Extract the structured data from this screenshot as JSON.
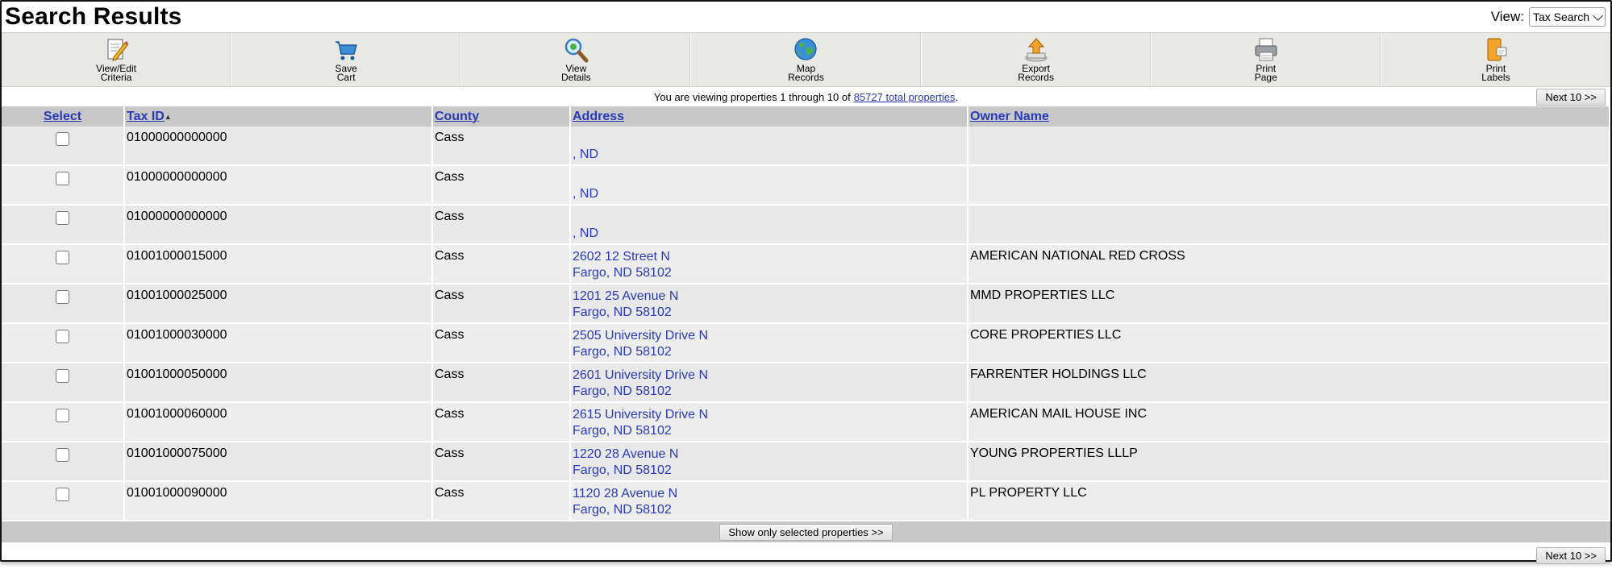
{
  "header": {
    "title": "Search Results",
    "view_label": "View:",
    "view_selected": "Tax Search"
  },
  "toolbar": [
    {
      "name": "view-edit-criteria",
      "icon": "edit-document-icon",
      "line1": "View/Edit",
      "line2": "Criteria"
    },
    {
      "name": "save-cart",
      "icon": "shopping-cart-icon",
      "line1": "Save",
      "line2": "Cart"
    },
    {
      "name": "view-details",
      "icon": "magnifier-icon",
      "line1": "View",
      "line2": "Details"
    },
    {
      "name": "map-records",
      "icon": "globe-icon",
      "line1": "Map",
      "line2": "Records"
    },
    {
      "name": "export-records",
      "icon": "export-upload-icon",
      "line1": "Export",
      "line2": "Records"
    },
    {
      "name": "print-page",
      "icon": "printer-icon",
      "line1": "Print",
      "line2": "Page"
    },
    {
      "name": "print-labels",
      "icon": "labels-icon",
      "line1": "Print",
      "line2": "Labels"
    }
  ],
  "info": {
    "prefix": "You are viewing properties 1 through 10 of",
    "link": "85727 total properties",
    "suffix": "."
  },
  "next_label": "Next 10 >>",
  "columns": {
    "select": "Select",
    "tax_id": "Tax ID",
    "county": "County",
    "address": "Address",
    "owner": "Owner Name"
  },
  "rows": [
    {
      "tax_id": "01000000000000",
      "county": "Cass",
      "addr1": "",
      "addr2": ", ND",
      "owner": ""
    },
    {
      "tax_id": "01000000000000",
      "county": "Cass",
      "addr1": "",
      "addr2": ", ND",
      "owner": ""
    },
    {
      "tax_id": "01000000000000",
      "county": "Cass",
      "addr1": "",
      "addr2": ", ND",
      "owner": ""
    },
    {
      "tax_id": "01001000015000",
      "county": "Cass",
      "addr1": "2602 12 Street N",
      "addr2": "Fargo, ND  58102",
      "owner": "AMERICAN NATIONAL RED CROSS"
    },
    {
      "tax_id": "01001000025000",
      "county": "Cass",
      "addr1": "1201 25 Avenue N",
      "addr2": "Fargo, ND  58102",
      "owner": "MMD PROPERTIES LLC"
    },
    {
      "tax_id": "01001000030000",
      "county": "Cass",
      "addr1": "2505 University Drive N",
      "addr2": "Fargo, ND  58102",
      "owner": "CORE PROPERTIES LLC"
    },
    {
      "tax_id": "01001000050000",
      "county": "Cass",
      "addr1": "2601 University Drive N",
      "addr2": "Fargo, ND  58102",
      "owner": "FARRENTER HOLDINGS LLC"
    },
    {
      "tax_id": "01001000060000",
      "county": "Cass",
      "addr1": "2615 University Drive N",
      "addr2": "Fargo, ND  58102",
      "owner": "AMERICAN MAIL HOUSE INC"
    },
    {
      "tax_id": "01001000075000",
      "county": "Cass",
      "addr1": "1220 28 Avenue N",
      "addr2": "Fargo, ND  58102",
      "owner": "YOUNG PROPERTIES LLLP"
    },
    {
      "tax_id": "01001000090000",
      "county": "Cass",
      "addr1": "1120 28 Avenue N",
      "addr2": "Fargo, ND  58102",
      "owner": "PL PROPERTY LLC"
    }
  ],
  "show_selected_label": "Show only selected properties >>",
  "colors": {
    "link": "#2a3ab8",
    "header_bg": "#c8c8c8",
    "row_bg": "#e8e8e8",
    "toolbar_bg": "#e8e8e4"
  }
}
